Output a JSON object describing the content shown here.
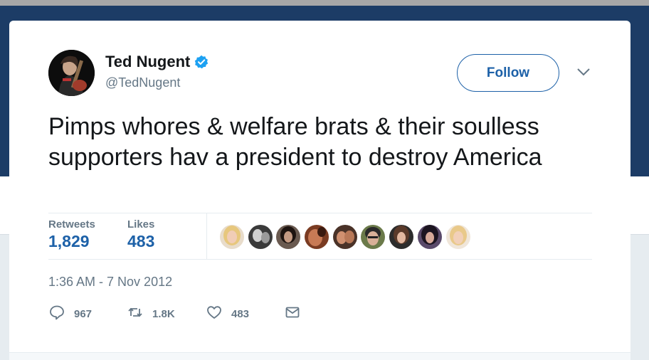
{
  "tweet": {
    "author_name": "Ted Nugent",
    "author_handle": "@TedNugent",
    "follow_label": "Follow",
    "text": "Pimps whores & welfare brats & their soulless supporters hav a president to destroy America",
    "stats": {
      "retweets_label": "Retweets",
      "retweets_value": "1,829",
      "likes_label": "Likes",
      "likes_value": "483"
    },
    "timestamp": "1:36 AM - 7 Nov 2012",
    "actions": {
      "reply_count": "967",
      "retweet_count": "1.8K",
      "like_count": "483"
    }
  },
  "colors": {
    "accent": "#1d61a8",
    "verified": "#1da1f2",
    "header_bg": "#1c3c66",
    "muted_text": "#657786"
  },
  "icons": {
    "verified": "verified-badge-icon",
    "caret": "chevron-down-icon",
    "reply": "reply-icon",
    "retweet": "retweet-icon",
    "like": "heart-icon",
    "message": "envelope-icon"
  }
}
